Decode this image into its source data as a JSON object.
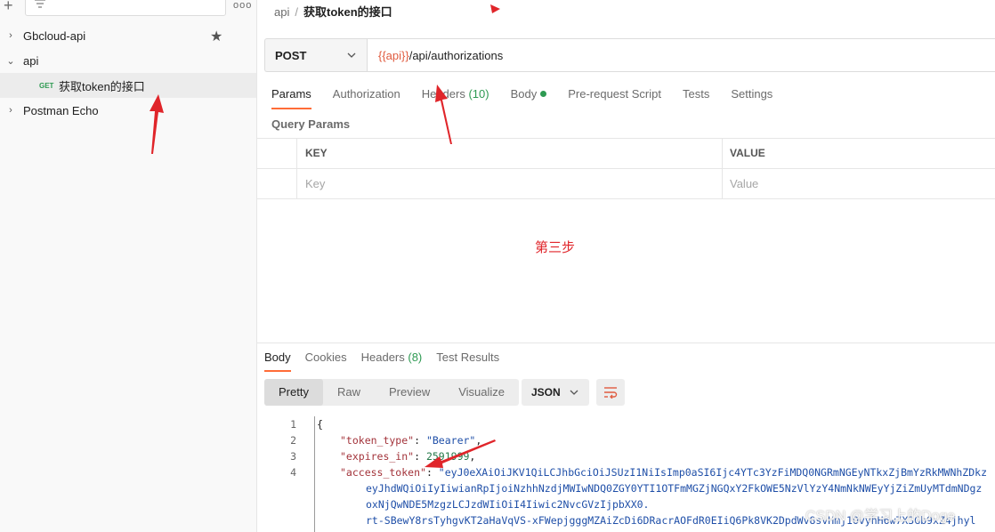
{
  "sidebar": {
    "more_label": "ooo",
    "items": [
      {
        "label": "Gbcloud-api",
        "expanded": false
      },
      {
        "label": "api",
        "expanded": true
      },
      {
        "method": "GET",
        "label": "获取token的接口"
      },
      {
        "label": "Postman Echo",
        "expanded": false
      }
    ]
  },
  "breadcrumb": {
    "parent": "api",
    "separator": "/",
    "current": "获取token的接口"
  },
  "request": {
    "method": "POST",
    "url_variable": "{{api}}",
    "url_path": "/api/authorizations"
  },
  "request_tabs": [
    {
      "label": "Params",
      "active": true
    },
    {
      "label": "Authorization"
    },
    {
      "label": "Headers",
      "count": "(10)"
    },
    {
      "label": "Body"
    },
    {
      "label": "Pre-request Script"
    },
    {
      "label": "Tests"
    },
    {
      "label": "Settings"
    }
  ],
  "query_params": {
    "title": "Query Params",
    "headers": {
      "key": "KEY",
      "value": "VALUE"
    },
    "placeholders": {
      "key": "Key",
      "value": "Value"
    }
  },
  "annotation_text": "第三步",
  "response": {
    "tabs": [
      {
        "label": "Body",
        "active": true
      },
      {
        "label": "Cookies"
      },
      {
        "label": "Headers",
        "count": "(8)"
      },
      {
        "label": "Test Results"
      }
    ],
    "views": [
      "Pretty",
      "Raw",
      "Preview",
      "Visualize"
    ],
    "format": "JSON",
    "body": {
      "line_numbers": [
        "1",
        "2",
        "3",
        "4"
      ],
      "open_brace": "{",
      "key1": "\"token_type\"",
      "val1": "\"Bearer\"",
      "key2": "\"expires_in\"",
      "val2": "2591999",
      "key3": "\"access_token\"",
      "token_lines": [
        "\"eyJ0eXAiOiJKV1QiLCJhbGciOiJSUzI1NiIsImp0aSI6Ijc4YTc3YzFiMDQ0NGRmNGEyNTkxZjBmYzRkMWNhZDkz",
        "eyJhdWQiOiIyIiwianRpIjoiNzhhNzdjMWIwNDQ0ZGY0YTI1OTFmMGZjNGQxY2FkOWE5NzVlYzY4NmNkNWEyYjZiZmUyMTdmNDgz",
        "oxNjQwNDE5MzgzLCJzdWIiOiI4Iiwic2NvcGVzIjpbXX0.",
        "rt-SBewY8rsTyhgvKT2aHaVqVS-xFWepjgggMZAiZcDi6DRacrAOFdR0EIiQ6Pk8VK2DpdWv8svHmj1OvyhH6w7X3Gb9xZ4jhyl"
      ]
    }
  },
  "watermark": "CSDN @学习上的Doge",
  "colors": {
    "accent": "#ff6c37",
    "annotation": "#e0252a",
    "count_green": "#2e9a52"
  }
}
